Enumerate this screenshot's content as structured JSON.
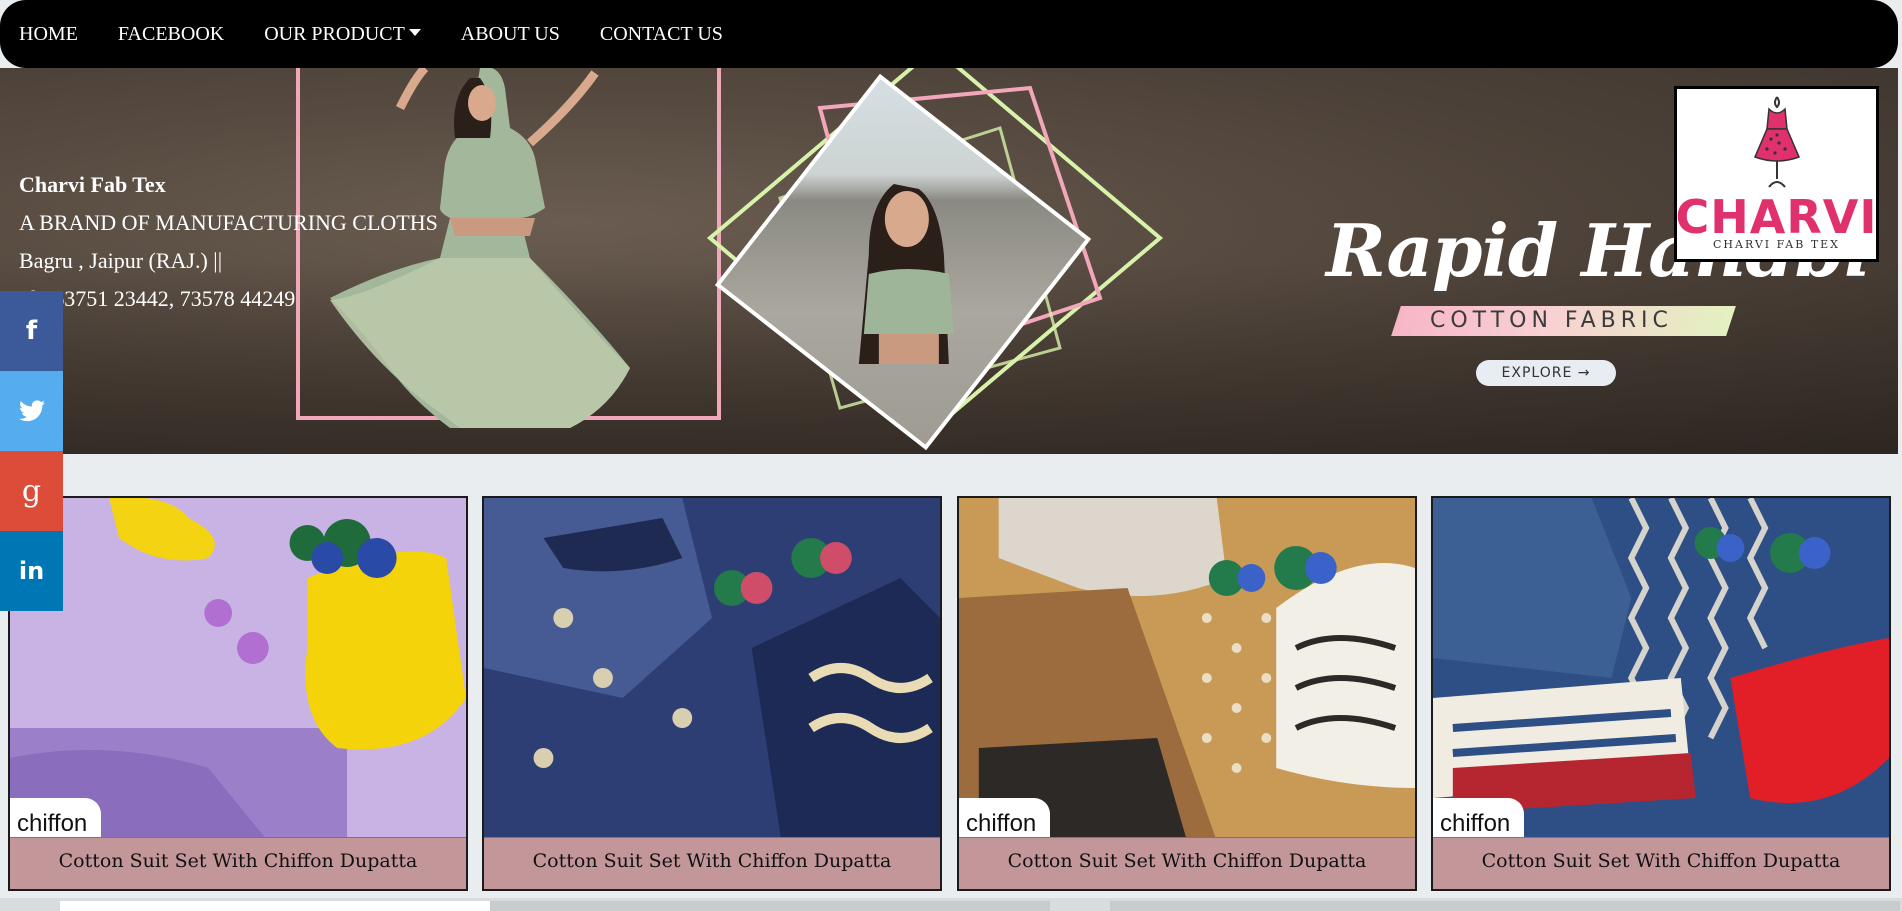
{
  "nav": {
    "items": [
      {
        "label": "HOME"
      },
      {
        "label": "FACEBOOK"
      },
      {
        "label": "OUR PRODUCT",
        "dropdown": true
      },
      {
        "label": "ABOUT US"
      },
      {
        "label": "CONTACT US"
      }
    ]
  },
  "hero": {
    "company": "Charvi Fab Tex",
    "tagline": "A BRAND OF MANUFACTURING CLOTHS",
    "address": "Bagru , Jaipur (RAJ.) ||",
    "phone": "Ph. 63751 23442, 73578 44249",
    "banner_title": "Rapid Handbl",
    "banner_subtitle": "COTTON FABRIC",
    "explore_label": "EXPLORE →"
  },
  "logo": {
    "word": "CHARVI",
    "small": "CHARVI FAB TEX"
  },
  "social": [
    {
      "name": "facebook",
      "glyph": "f"
    },
    {
      "name": "twitter",
      "glyph": "t"
    },
    {
      "name": "google-plus",
      "glyph": "g"
    },
    {
      "name": "linkedin",
      "glyph": "in"
    }
  ],
  "products": [
    {
      "tag": "chiffon",
      "caption": "Cotton Suit Set With Chiffon Dupatta"
    },
    {
      "tag": "",
      "caption": "Cotton Suit Set With Chiffon Dupatta"
    },
    {
      "tag": "chiffon",
      "caption": "Cotton Suit Set With Chiffon Dupatta"
    },
    {
      "tag": "chiffon",
      "caption": "Cotton Suit Set With Chiffon Dupatta"
    }
  ],
  "colors": {
    "nav_bg": "#000000",
    "caption_bg": "#c3969a",
    "facebook": "#3c5a99",
    "twitter": "#55acee",
    "google_plus": "#dd4b39",
    "linkedin": "#0077b5",
    "logo_pink": "#e0306d"
  }
}
